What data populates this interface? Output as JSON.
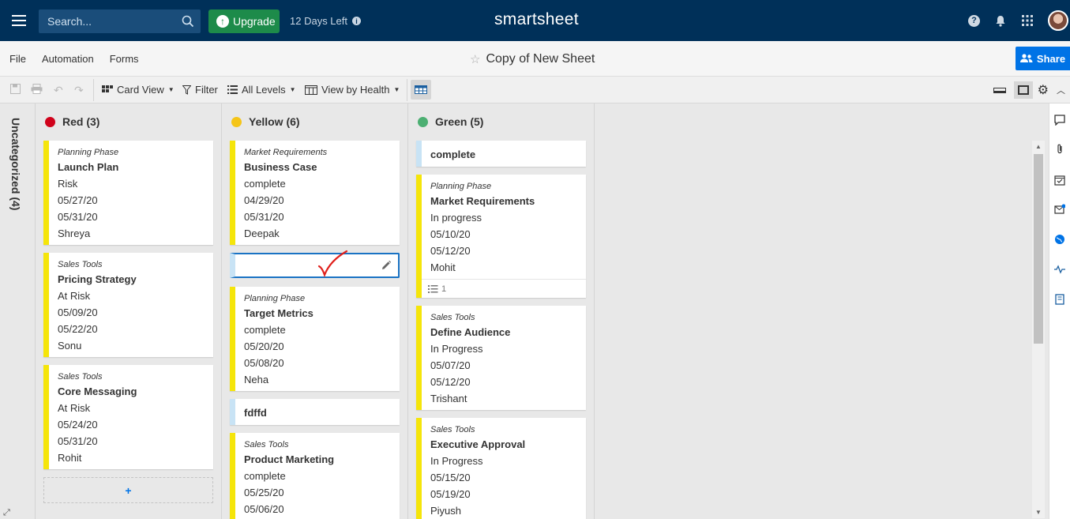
{
  "topbar": {
    "search_placeholder": "Search...",
    "upgrade_label": "Upgrade",
    "trial_text": "12 Days Left",
    "logo": "smartsheet"
  },
  "menu": {
    "items": [
      "File",
      "Automation",
      "Forms"
    ],
    "sheet_title": "Copy of New Sheet",
    "share_label": "Share"
  },
  "toolbar": {
    "card_view": "Card View",
    "filter": "Filter",
    "all_levels": "All Levels",
    "view_by": "View by Health"
  },
  "board": {
    "uncategorized": "Uncategorized (4)",
    "lanes": [
      {
        "title": "Red (3)",
        "color": "#d0021b",
        "cards": [
          {
            "phase": "Planning Phase",
            "title": "Launch Plan",
            "status": "Risk",
            "start": "05/27/20",
            "end": "05/31/20",
            "owner": "Shreya"
          },
          {
            "phase": "Sales Tools",
            "title": "Pricing Strategy",
            "status": "At Risk",
            "start": "05/09/20",
            "end": "05/22/20",
            "owner": "Sonu"
          },
          {
            "phase": "Sales Tools",
            "title": "Core Messaging",
            "status": "At Risk",
            "start": "05/24/20",
            "end": "05/31/20",
            "owner": "Rohit"
          }
        ],
        "add_label": "+"
      },
      {
        "title": "Yellow (6)",
        "color": "#f5c518",
        "cards": [
          {
            "phase": "Market Requirements",
            "title": "Business Case",
            "status": "complete",
            "start": "04/29/20",
            "end": "05/31/20",
            "owner": "Deepak"
          },
          {
            "phase": "Planning Phase",
            "title": "Target Metrics",
            "status": "complete",
            "start": "05/20/20",
            "end": "05/08/20",
            "owner": "Neha"
          },
          {
            "title": "fdffd"
          },
          {
            "phase": "Sales Tools",
            "title": "Product Marketing",
            "status": "complete",
            "start": "05/25/20",
            "end": "05/06/20"
          }
        ]
      },
      {
        "title": "Green (5)",
        "color": "#4caf72",
        "cards": [
          {
            "title": "complete"
          },
          {
            "phase": "Planning Phase",
            "title": "Market Requirements",
            "status": "In progress",
            "start": "05/10/20",
            "end": "05/12/20",
            "owner": "Mohit",
            "subtasks": "1"
          },
          {
            "phase": "Sales Tools",
            "title": "Define Audience",
            "status": "In Progress",
            "start": "05/07/20",
            "end": "05/12/20",
            "owner": "Trishant"
          },
          {
            "phase": "Sales Tools",
            "title": "Executive Approval",
            "status": "In Progress",
            "start": "05/15/20",
            "end": "05/19/20",
            "owner": "Piyush"
          }
        ]
      }
    ]
  },
  "colors": {
    "nav": "#003059",
    "upgrade": "#1d8b4a",
    "share": "#0073e6",
    "card_accent": "#f5e50a",
    "card_accent_blank": "#c8e3f5",
    "edit_outline": "#1a73c4",
    "checkmark": "#e0201c"
  },
  "icons": [
    "hamburger-icon",
    "search-icon",
    "upload-icon",
    "info-icon",
    "help-icon",
    "bell-icon",
    "apps-grid-icon",
    "avatar",
    "star-icon",
    "share-people-icon",
    "save-icon",
    "print-icon",
    "undo-icon",
    "redo-icon",
    "card-view-icon",
    "filter-icon",
    "levels-icon",
    "view-by-icon",
    "grid-view-icon",
    "collapse-row-icon",
    "expand-card-icon",
    "gear-icon",
    "chevron-up-icon",
    "comment-icon",
    "attachment-icon",
    "proof-icon",
    "update-request-icon",
    "publish-icon",
    "activity-icon",
    "summary-icon",
    "pencil-icon",
    "checkmark-annotation",
    "fullscreen-icon"
  ]
}
